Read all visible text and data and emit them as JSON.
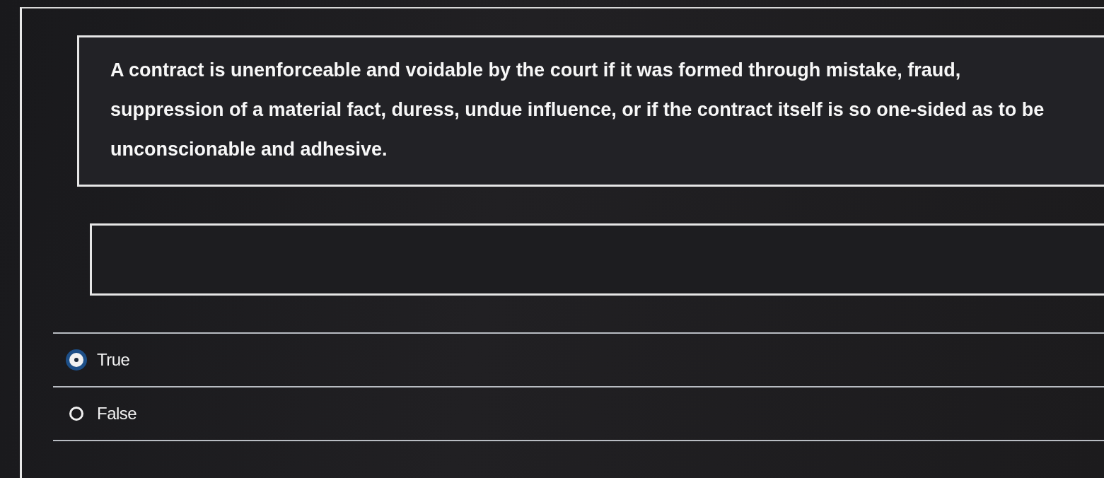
{
  "question": {
    "text": "A contract is unenforceable and voidable by the court if it was formed through mistake, fraud, suppression of a material fact, duress, undue influence, or if the contract itself is so one-sided as to be unconscionable and adhesive."
  },
  "options": [
    {
      "label": "True",
      "selected": true
    },
    {
      "label": "False",
      "selected": false
    }
  ]
}
